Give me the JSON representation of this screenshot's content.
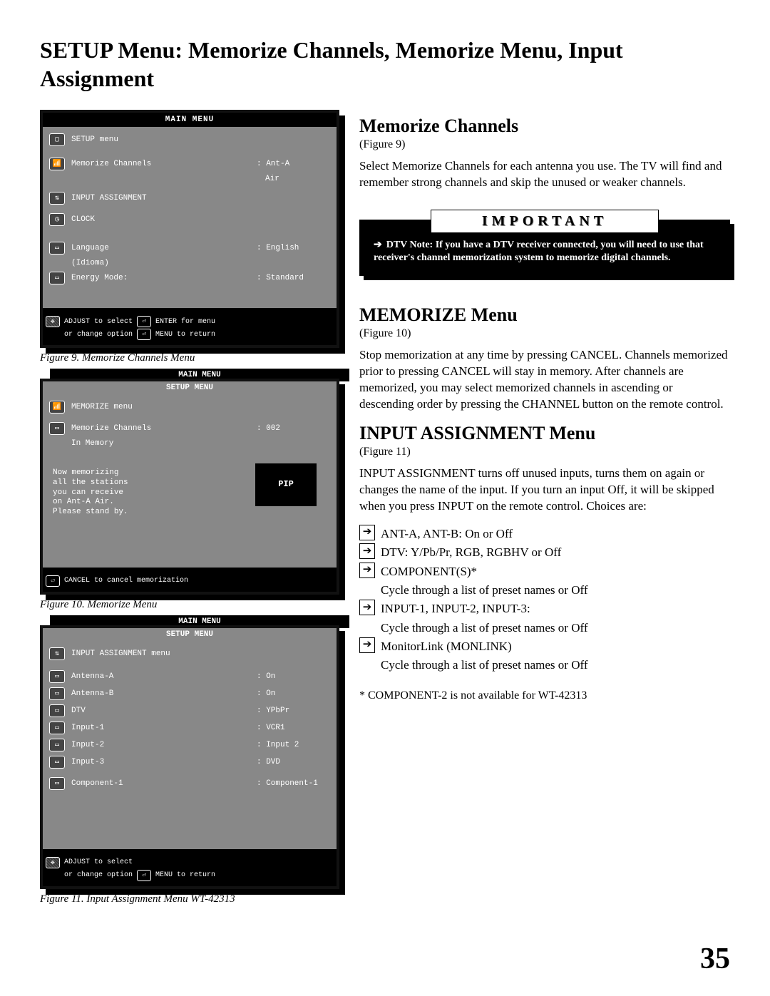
{
  "page": {
    "title": "SETUP Menu: Memorize Channels, Memorize Menu, Input Assignment",
    "number": "35"
  },
  "figure9": {
    "header": "MAIN MENU",
    "rows": [
      {
        "icon": "tv",
        "label": "SETUP menu",
        "value": ""
      },
      {
        "icon": "ant",
        "label": "Memorize Channels",
        "value": "Ant-A"
      },
      {
        "icon": "blank",
        "label": "",
        "value": "Air"
      },
      {
        "icon": "ud",
        "label": "INPUT ASSIGNMENT",
        "value": ""
      },
      {
        "icon": "clock",
        "label": "CLOCK",
        "value": ""
      },
      {
        "icon": "sq",
        "label": "Language",
        "value": "English"
      },
      {
        "icon": "blank",
        "label": "(Idioma)",
        "value": ""
      },
      {
        "icon": "sq",
        "label": "Energy Mode:",
        "value": "Standard"
      }
    ],
    "footer1": "ADJUST to select",
    "footer1b": "ENTER for menu",
    "footer2": "or change option",
    "footer2b": "MENU to return",
    "caption": "Figure 9.  Memorize Channels Menu"
  },
  "figure10": {
    "back": "MAIN MENU",
    "header": "SETUP MENU",
    "rows": [
      {
        "icon": "ant",
        "label": "MEMORIZE menu",
        "value": ""
      },
      {
        "icon": "sq",
        "label": "Memorize Channels",
        "value": "002"
      },
      {
        "icon": "blank",
        "label": "In Memory",
        "value": ""
      }
    ],
    "msg1": "Now memorizing",
    "msg2": "all the stations",
    "msg3": "you can receive",
    "msg4": "on Ant-A Air.",
    "msg5": "Please stand by.",
    "pip": "PIP",
    "footer": "CANCEL to cancel memorization",
    "caption": "Figure 10.  Memorize Menu"
  },
  "figure11": {
    "back": "MAIN MENU",
    "header": "SETUP MENU",
    "toprow": {
      "label": "INPUT ASSIGNMENT menu"
    },
    "rows": [
      {
        "label": "Antenna-A",
        "value": "On"
      },
      {
        "label": "Antenna-B",
        "value": "On"
      },
      {
        "label": "DTV",
        "value": "YPbPr"
      },
      {
        "label": "Input-1",
        "value": "VCR1"
      },
      {
        "label": "Input-2",
        "value": "Input 2"
      },
      {
        "label": "Input-3",
        "value": "DVD"
      },
      {
        "label": "Component-1",
        "value": "Component-1"
      }
    ],
    "footer1": "ADJUST to select",
    "footer2": "or change option",
    "footer2b": "MENU to return",
    "caption": "Figure 11.  Input Assignment Menu WT-42313"
  },
  "right": {
    "h_memchan": "Memorize Channels",
    "fig9": "(Figure 9)",
    "p_memchan": "Select Memorize Channels for each antenna you use. The TV will find and remember strong channels and skip the unused or weaker channels.",
    "important_head": "IMPORTANT",
    "important_body": "DTV  Note: If you have a  DTV receiver connected, you will need to use that receiver's channel memorization system to memorize digital channels.",
    "h_memmenu": "MEMORIZE Menu",
    "fig10": "(Figure 10)",
    "p_memmenu": "Stop memorization at any time by pressing CANCEL. Channels memorized prior to pressing CANCEL will stay in memory.  After channels are memorized, you may select memorized channels in ascending or descending order by pressing the CHANNEL button on the remote control.",
    "h_input": "INPUT ASSIGNMENT Menu",
    "fig11": "(Figure 11)",
    "p_input": "INPUT ASSIGNMENT turns off unused inputs, turns them on again or changes the name of the input. If you turn an input Off, it will be skipped when you press INPUT on the remote control.  Choices are:",
    "choice1": "ANT-A, ANT-B: On or Off",
    "choice2": "DTV: Y/Pb/Pr, RGB, RGBHV or Off",
    "choice3": "COMPONENT(S)*",
    "choice3b": "Cycle through a list of preset names or Off",
    "choice4": "INPUT-1, INPUT-2, INPUT-3:",
    "choice4b": "Cycle through a list of preset names or Off",
    "choice5": "MonitorLink (MONLINK)",
    "choice5b": "Cycle through a list of preset names or Off",
    "footnote": "* COMPONENT-2 is not available for WT-42313"
  }
}
